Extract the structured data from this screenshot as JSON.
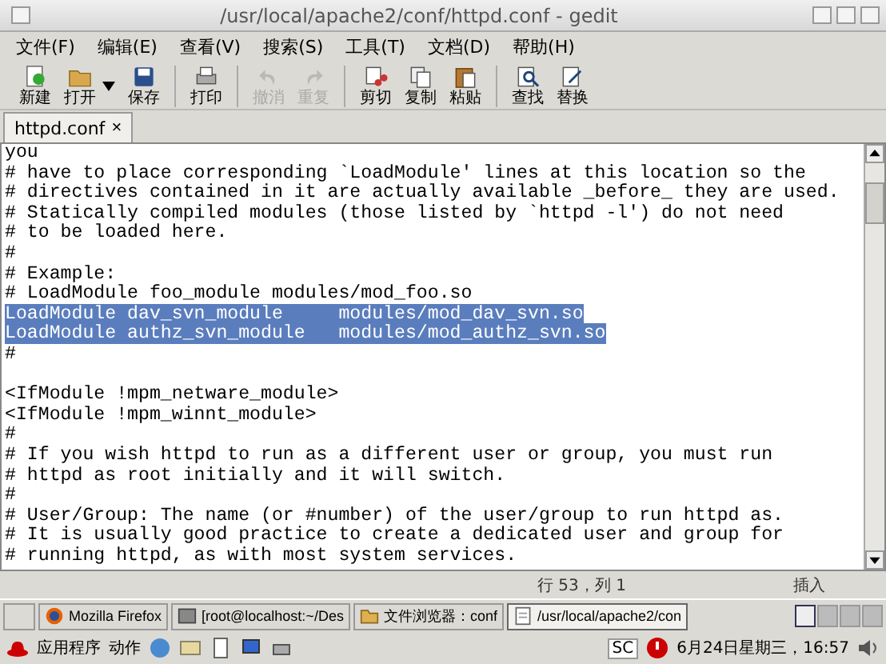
{
  "window": {
    "title": "/usr/local/apache2/conf/httpd.conf - gedit"
  },
  "menu": [
    "文件(F)",
    "编辑(E)",
    "查看(V)",
    "搜索(S)",
    "工具(T)",
    "文档(D)",
    "帮助(H)"
  ],
  "toolbar": {
    "groups": [
      [
        {
          "label": "新建",
          "disabled": false,
          "dropdown": false
        },
        {
          "label": "打开",
          "disabled": false,
          "dropdown": true
        },
        {
          "label": "保存",
          "disabled": false,
          "dropdown": false
        }
      ],
      [
        {
          "label": "打印",
          "disabled": false,
          "dropdown": false
        }
      ],
      [
        {
          "label": "撤消",
          "disabled": true,
          "dropdown": false
        },
        {
          "label": "重复",
          "disabled": true,
          "dropdown": false
        }
      ],
      [
        {
          "label": "剪切",
          "disabled": false,
          "dropdown": false
        },
        {
          "label": "复制",
          "disabled": false,
          "dropdown": false
        },
        {
          "label": "粘贴",
          "disabled": false,
          "dropdown": false
        }
      ],
      [
        {
          "label": "查找",
          "disabled": false,
          "dropdown": false
        },
        {
          "label": "替换",
          "disabled": false,
          "dropdown": false
        }
      ]
    ]
  },
  "tabs": [
    {
      "label": "httpd.conf",
      "selected": true,
      "close": "×"
    }
  ],
  "editor": {
    "lines": [
      {
        "kind": "text",
        "text": "you",
        "selected": false
      },
      {
        "kind": "text",
        "text": "# have to place corresponding `LoadModule' lines at this location so the",
        "selected": false
      },
      {
        "kind": "text",
        "text": "# directives contained in it are actually available _before_ they are used.",
        "selected": false
      },
      {
        "kind": "text",
        "text": "# Statically compiled modules (those listed by `httpd -l') do not need",
        "selected": false
      },
      {
        "kind": "text",
        "text": "# to be loaded here.",
        "selected": false
      },
      {
        "kind": "text",
        "text": "#",
        "selected": false
      },
      {
        "kind": "text",
        "text": "# Example:",
        "selected": false
      },
      {
        "kind": "text",
        "text": "# LoadModule foo_module modules/mod_foo.so",
        "selected": false
      },
      {
        "kind": "text",
        "text": "LoadModule dav_svn_module     modules/mod_dav_svn.so",
        "selected": true
      },
      {
        "kind": "text",
        "text": "LoadModule authz_svn_module   modules/mod_authz_svn.so",
        "selected": true
      },
      {
        "kind": "text",
        "text": "#",
        "selected": false
      },
      {
        "kind": "blank"
      },
      {
        "kind": "text",
        "text": "<IfModule !mpm_netware_module>",
        "selected": false
      },
      {
        "kind": "text",
        "text": "<IfModule !mpm_winnt_module>",
        "selected": false
      },
      {
        "kind": "text",
        "text": "#",
        "selected": false
      },
      {
        "kind": "text",
        "text": "# If you wish httpd to run as a different user or group, you must run",
        "selected": false
      },
      {
        "kind": "text",
        "text": "# httpd as root initially and it will switch.",
        "selected": false
      },
      {
        "kind": "text",
        "text": "#",
        "selected": false
      },
      {
        "kind": "text",
        "text": "# User/Group: The name (or #number) of the user/group to run httpd as.",
        "selected": false
      },
      {
        "kind": "text",
        "text": "# It is usually good practice to create a dedicated user and group for",
        "selected": false
      },
      {
        "kind": "text",
        "text": "# running httpd, as with most system services.",
        "selected": false
      }
    ]
  },
  "status_bar": {
    "position": "行 53，列 1",
    "mode": "插入"
  },
  "taskbar": {
    "windows": [
      {
        "label": "Mozilla Firefox",
        "selected": false,
        "kind": "browser"
      },
      {
        "label": "[root@localhost:~/Des",
        "selected": false,
        "kind": "terminal"
      },
      {
        "label": "文件浏览器：conf",
        "selected": false,
        "kind": "folder"
      },
      {
        "label": "/usr/local/apache2/con",
        "selected": true,
        "kind": "editor"
      }
    ],
    "workspaces": [
      {
        "selected": true
      },
      {
        "selected": false
      },
      {
        "selected": false
      },
      {
        "selected": false
      }
    ]
  },
  "panel": {
    "menus": [
      "应用程序",
      "动作"
    ],
    "input_method": "SC",
    "clock": "6月24日星期三，16:57"
  }
}
